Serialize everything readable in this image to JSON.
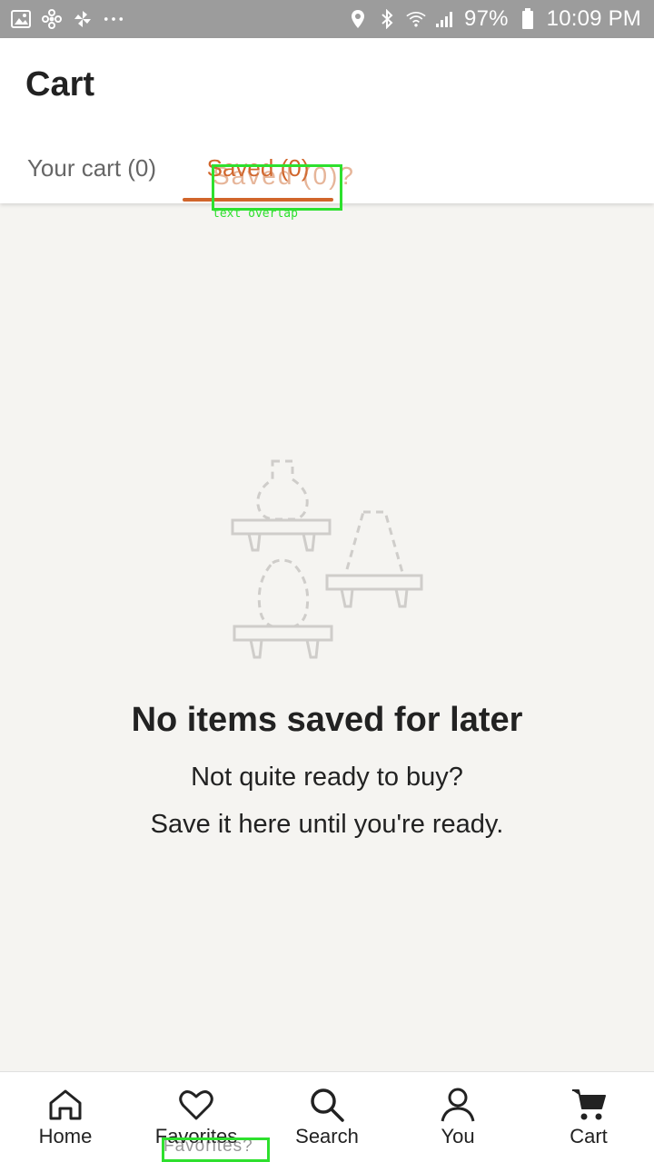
{
  "status_bar": {
    "battery": "97%",
    "time": "10:09 PM",
    "left_icons": [
      "image-icon",
      "fan-icon",
      "pinwheel-icon",
      "more-dots-icon"
    ],
    "right_icons": [
      "location-icon",
      "bluetooth-icon",
      "wifi-icon",
      "signal-icon",
      "battery-icon"
    ]
  },
  "header": {
    "title": "Cart",
    "tabs": [
      {
        "label": "Your cart (0)",
        "active": false
      },
      {
        "label": "Saved (0)",
        "active": true
      }
    ]
  },
  "overlays": {
    "saved_ghost": "Saved (0)?",
    "saved_note": "text overlap",
    "favorites_ghost": "Favorites?"
  },
  "empty_state": {
    "title": "No items saved for later",
    "line1": "Not quite ready to buy?",
    "line2": "Save it here until you're ready."
  },
  "bottom_nav": {
    "items": [
      {
        "label": "Home",
        "icon": "home-icon"
      },
      {
        "label": "Favorites",
        "icon": "heart-icon"
      },
      {
        "label": "Search",
        "icon": "search-icon"
      },
      {
        "label": "You",
        "icon": "person-icon"
      },
      {
        "label": "Cart",
        "icon": "cart-icon"
      }
    ]
  },
  "colors": {
    "accent": "#d1652b",
    "status_bar": "#9c9c9c",
    "background": "#f5f4f1",
    "debug": "#2ee02e"
  }
}
